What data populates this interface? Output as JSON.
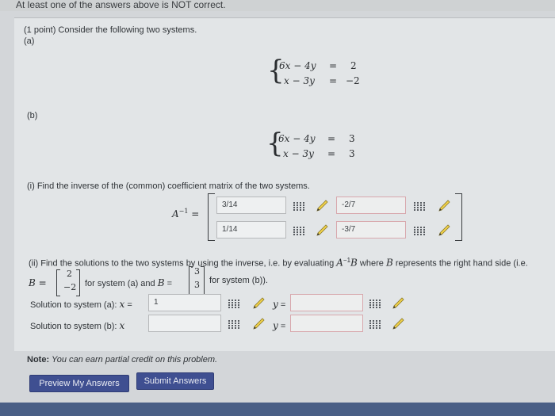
{
  "banner": "At least one of the answers above is NOT correct.",
  "problem": {
    "intro": "(1 point) Consider the following two systems.",
    "part_a": "(a)",
    "part_b": "(b)",
    "system_a": {
      "row1": {
        "lhs": "6x − 4y",
        "eq": "=",
        "rhs": "2"
      },
      "row2": {
        "lhs": "x − 3y",
        "eq": "=",
        "rhs": "−2"
      }
    },
    "system_b": {
      "row1": {
        "lhs": "6x − 4y",
        "eq": "=",
        "rhs": "3"
      },
      "row2": {
        "lhs": "x − 3y",
        "eq": "=",
        "rhs": "3"
      }
    },
    "q1": "(i) Find the inverse of the (common) coefficient matrix of the two systems.",
    "a_inv_label": "A",
    "a_inv_sup": "−1",
    "a_inv_eq": "=",
    "matrix": {
      "m11": "3/14",
      "m12": "-2/7",
      "m21": "1/14",
      "m22": "-3/7"
    },
    "q2_start": "(ii) Find the solutions to the two systems by using the inverse, i.e. by evaluating ",
    "q2_A": "A",
    "q2_sup": "−1",
    "q2_B": "B",
    "q2_end": " where ",
    "q2_B2": "B",
    "q2_tail": " represents the right hand side (i.e.",
    "b_label": "B",
    "b_eq": "=",
    "b_a": {
      "top": "2",
      "bottom": "−2"
    },
    "for_a": "for system (a) and ",
    "b_label2": "B",
    "b_eq2": "=",
    "b_b": {
      "top": "3",
      "bottom": "3"
    },
    "for_b": "for system (b)).",
    "sol_a_label": "Solution to system (a): ",
    "sol_b_label": "Solution to system (b): ",
    "x_var": "x",
    "y_var": "y",
    "eq": "=",
    "sol_a_x": "1",
    "sol_a_y": "",
    "sol_b_x": "",
    "sol_b_y": "",
    "note_bold": "Note:",
    "note_italic": " You can earn partial credit on this problem."
  },
  "buttons": {
    "preview": "Preview My Answers",
    "submit": "Submit Answers"
  }
}
